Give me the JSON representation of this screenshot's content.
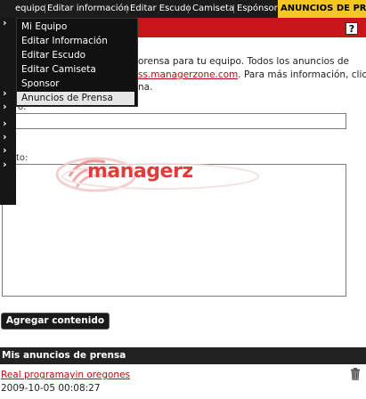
{
  "nav": {
    "items": [
      "equipo",
      "Editar información",
      "Editar Escudo",
      "Camiseta",
      "Espónsor"
    ],
    "active": "ANUNCIOS DE PRENSA"
  },
  "dropdown": {
    "items": [
      "Mi Equipo",
      "Editar Información",
      "Editar Escudo",
      "Editar Camiseta",
      "Sponsor",
      "Anuncios de Prensa"
    ],
    "selected": "Anuncios de Prensa"
  },
  "help": {
    "label": "?"
  },
  "intro": {
    "line1": "orensa para tu equipo. Todos los anuncios de",
    "line2_link": "ss.managerzone.com",
    "line2_rest": ". Para más información, click",
    "line3": "na."
  },
  "form": {
    "title_label": "o:",
    "title_value": "",
    "content_label": "to:",
    "content_value": "",
    "submit_label": "Agregar contenido"
  },
  "watermark": {
    "text": "managerz"
  },
  "my_ads": {
    "heading": "Mis anuncios de prensa",
    "items": [
      {
        "title": "Real programayin oregones",
        "date": "2009-10-05 00:08:27"
      }
    ]
  },
  "colors": {
    "nav_bg": "#1c1c1c",
    "nav_active": "#f4c623",
    "banner": "#c6151b",
    "link": "#b01010",
    "section_bar": "#222222"
  }
}
